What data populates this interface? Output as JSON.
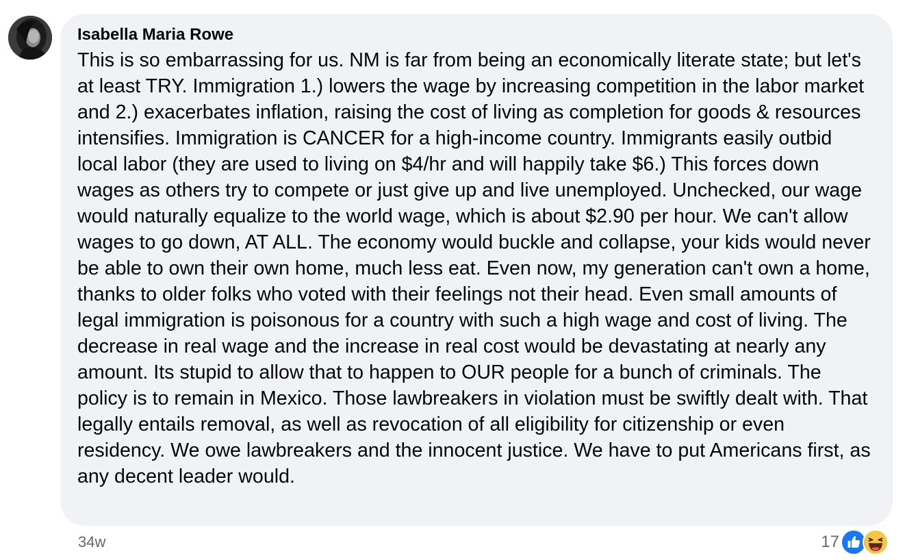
{
  "comment": {
    "author": "Isabella Maria Rowe",
    "text": "This is so embarrassing for us. NM is far from being an economically literate state; but let's at least TRY. Immigration 1.) lowers the wage by increasing competition in the labor market and 2.) exacerbates inflation, raising the cost of living as completion for goods & resources intensifies. Immigration is CANCER for a high-income country. Immigrants easily outbid local labor (they are used to living on $4/hr and will happily take $6.) This forces down wages as others try to compete or just give up and live unemployed. Unchecked, our wage would naturally equalize to the world wage, which is about $2.90 per hour. We can't allow wages to go down, AT ALL. The economy would buckle and collapse, your kids would never be able to own their own home, much less eat. Even now, my generation can't own a home, thanks to older folks who voted with their feelings not their head. Even small amounts of legal immigration is poisonous for a country with such a high wage and cost of living. The decrease in real wage and the increase in real cost would be devastating at nearly any amount. Its stupid to allow that to happen to OUR people for a bunch of criminals. The policy is to remain in Mexico. Those lawbreakers in violation must be swiftly dealt with. That legally entails removal, as well as revocation of all eligibility for citizenship or even residency. We owe lawbreakers and the innocent justice. We have to put Americans first, as any decent leader would.",
    "timestamp": "34w",
    "reaction_count": "17",
    "reaction_icons": [
      "like-icon",
      "haha-icon"
    ]
  },
  "colors": {
    "bubble_bg": "#f0f2f5",
    "text": "#050505",
    "secondary_text": "#65676b",
    "like_blue": "#1877f2",
    "haha_yellow": "#f7c544"
  }
}
